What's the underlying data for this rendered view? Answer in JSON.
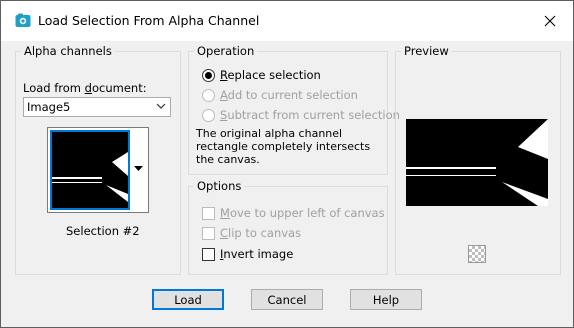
{
  "window": {
    "title": "Load Selection From Alpha Channel"
  },
  "alpha_channels": {
    "group_title": "Alpha channels",
    "load_from_label_pre": "Load from ",
    "load_from_label_u": "d",
    "load_from_label_post": "ocument:",
    "document_value": "Image5",
    "selection_name": "Selection #2"
  },
  "operation": {
    "group_title": "Operation",
    "options": [
      {
        "pre": "",
        "u": "R",
        "post": "eplace selection",
        "selected": true,
        "enabled": true
      },
      {
        "pre": "",
        "u": "A",
        "post": "dd to current selection",
        "selected": false,
        "enabled": false
      },
      {
        "pre": "",
        "u": "S",
        "post": "ubtract from current selection",
        "selected": false,
        "enabled": false
      }
    ],
    "description": "The original alpha channel rectangle completely intersects the canvas."
  },
  "options": {
    "group_title": "Options",
    "move": {
      "pre": "",
      "u": "M",
      "post": "ove to upper left of canvas",
      "checked": false,
      "enabled": false
    },
    "clip": {
      "pre": "",
      "u": "C",
      "post": "lip to canvas",
      "checked": false,
      "enabled": false
    },
    "invert": {
      "pre": "",
      "u": "I",
      "post": "nvert image",
      "checked": false,
      "enabled": true
    }
  },
  "preview": {
    "group_title": "Preview"
  },
  "buttons": {
    "load": "Load",
    "cancel": "Cancel",
    "help": "Help"
  }
}
